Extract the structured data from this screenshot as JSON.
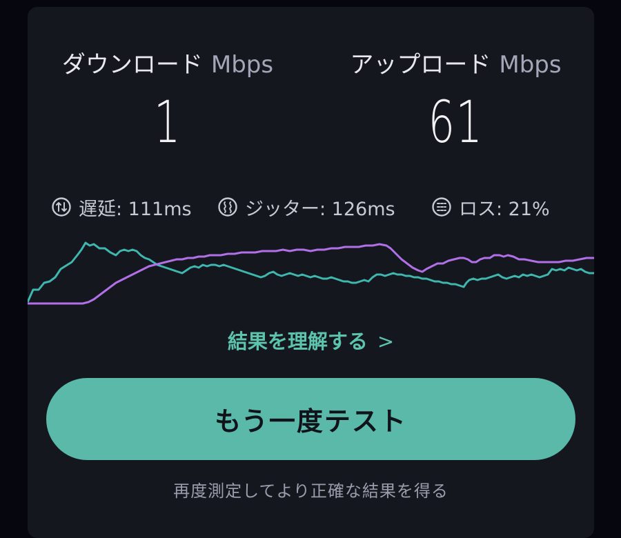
{
  "download": {
    "label": "ダウンロード",
    "unit": "Mbps",
    "value": "1"
  },
  "upload": {
    "label": "アップロード",
    "unit": "Mbps",
    "value": "61"
  },
  "metrics": {
    "latency": {
      "label": "遅延: 111ms",
      "icon": "latency-icon"
    },
    "jitter": {
      "label": "ジッター: 126ms",
      "icon": "jitter-icon"
    },
    "loss": {
      "label": "ロス: 21%",
      "icon": "loss-icon"
    }
  },
  "graph": {
    "download_color": "#3fb6ae",
    "upload_color": "#b270e8"
  },
  "understand_link": {
    "label": "結果を理解する",
    "chevron": ">"
  },
  "retest_button": {
    "label": "もう一度テスト",
    "color": "#5ab9a9"
  },
  "hint": "再度測定してより正確な結果を得る"
}
